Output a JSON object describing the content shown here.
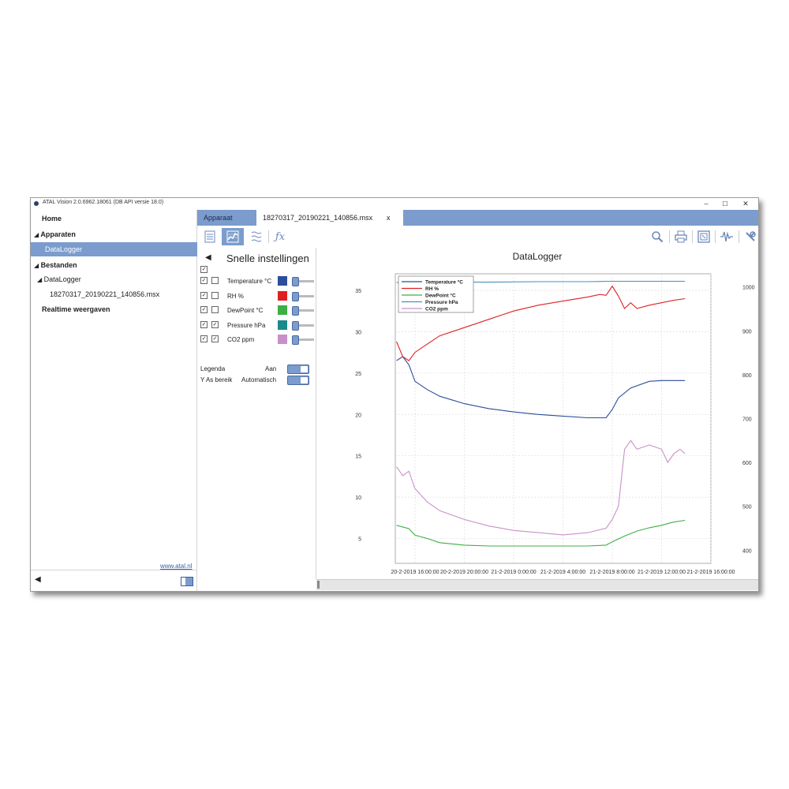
{
  "window": {
    "title": "ATAL Vision 2.0.6962.18061 (DB API versie 18.0)",
    "controls": {
      "minimize": "–",
      "maximize": "☐",
      "close": "✕"
    }
  },
  "sidebar": {
    "items": [
      {
        "label": "Home",
        "style": "bold"
      },
      {
        "label": "Apparaten",
        "style": "bold",
        "expander": "expanded"
      },
      {
        "label": "DataLogger",
        "style": "selected"
      },
      {
        "label": "Bestanden",
        "style": "bold",
        "expander": "expanded"
      },
      {
        "label": "DataLogger",
        "expander": "expanded"
      },
      {
        "label": "18270317_20190221_140856.msx"
      },
      {
        "label": "Realtime weergaven",
        "style": "bold"
      }
    ],
    "link": "www.atal.nl"
  },
  "tabs": {
    "apparaat": "Apparaat",
    "file": "18270317_20190221_140856.msx",
    "close": "x"
  },
  "quick_settings": {
    "title": "Snelle instellingen",
    "series": [
      {
        "label": "Temperature °C",
        "visible": true,
        "second_check": false,
        "color": "#2b4d9a"
      },
      {
        "label": "RH %",
        "visible": true,
        "second_check": false,
        "color": "#e02020"
      },
      {
        "label": "DewPoint °C",
        "visible": true,
        "second_check": false,
        "color": "#3cb043"
      },
      {
        "label": "Pressure hPa",
        "visible": true,
        "second_check": true,
        "color": "#1a8a8a"
      },
      {
        "label": "CO2 ppm",
        "visible": true,
        "second_check": true,
        "color": "#c890c8"
      }
    ],
    "legenda_label": "Legenda",
    "legenda_value": "Aan",
    "yas_label": "Y As bereik",
    "yas_value": "Automatisch"
  },
  "chart_data": {
    "type": "line",
    "title": "DataLogger",
    "legend": [
      "Temperature °C",
      "RH %",
      "DewPoint °C",
      "Pressure hPa",
      "CO2 ppm"
    ],
    "legend_position": "top-left",
    "grid": true,
    "x_ticks": [
      "20-2-2019 16:00:00",
      "20-2-2019 20:00:00",
      "21-2-2019 0:00:00",
      "21-2-2019 4:00:00",
      "21-2-2019 8:00:00",
      "21-2-2019 12:00:00",
      "21-2-2019 16:00:00"
    ],
    "x_range_hours": [
      0,
      24
    ],
    "y_left_ticks": [
      5,
      10,
      15,
      20,
      25,
      30,
      35
    ],
    "y_left_range": [
      2,
      37
    ],
    "y_right_ticks": [
      400,
      500,
      600,
      700,
      800,
      900,
      1000
    ],
    "y_right_range": [
      370,
      1030
    ],
    "series": [
      {
        "name": "Temperature °C",
        "axis": "left",
        "color": "#2b4d9a",
        "x": [
          14.5,
          15,
          15.5,
          16,
          17,
          18,
          20,
          22,
          0,
          2,
          4,
          6,
          7.5,
          8,
          8.5,
          9.5,
          11,
          12,
          13.9
        ],
        "y": [
          26.5,
          27,
          26,
          24,
          23,
          22.2,
          21.3,
          20.7,
          20.3,
          20,
          19.8,
          19.6,
          19.6,
          20.6,
          22,
          23.2,
          24,
          24.1,
          24.1
        ]
      },
      {
        "name": "RH %",
        "axis": "left",
        "color": "#e02020",
        "x": [
          14.5,
          15,
          15.5,
          16,
          17,
          18,
          20,
          22,
          0,
          2,
          4,
          6,
          7,
          7.5,
          8,
          8.5,
          9,
          9.5,
          10,
          11,
          12,
          13,
          13.9
        ],
        "y": [
          28.8,
          27,
          26.5,
          27.5,
          28.5,
          29.5,
          30.5,
          31.5,
          32.5,
          33.2,
          33.7,
          34.2,
          34.5,
          34.4,
          35.5,
          34.3,
          32.8,
          33.5,
          32.8,
          33.2,
          33.5,
          33.8,
          34
        ]
      },
      {
        "name": "DewPoint °C",
        "axis": "left",
        "color": "#3cb043",
        "x": [
          14.5,
          15.5,
          16,
          17,
          18,
          20,
          22,
          0,
          2,
          4,
          6,
          7.5,
          8,
          9,
          10,
          11,
          12,
          13,
          13.9
        ],
        "y": [
          6.6,
          6.2,
          5.4,
          5,
          4.5,
          4.2,
          4.1,
          4.1,
          4.1,
          4.1,
          4.1,
          4.2,
          4.6,
          5.3,
          5.9,
          6.3,
          6.6,
          7,
          7.2
        ]
      },
      {
        "name": "Pressure hPa",
        "axis": "right",
        "color": "#4a90b8",
        "x": [
          14.5,
          18,
          22,
          2,
          6,
          8,
          10,
          13.9
        ],
        "y": [
          1010,
          1011,
          1011,
          1012,
          1012,
          1013,
          1013,
          1013
        ]
      },
      {
        "name": "CO2 ppm",
        "axis": "right",
        "color": "#c890c8",
        "x": [
          14.5,
          15,
          15.5,
          16,
          17,
          18,
          20,
          22,
          0,
          2,
          4,
          6,
          7.5,
          8,
          8.5,
          9,
          9.5,
          10,
          11,
          12,
          12.5,
          13,
          13.5,
          13.9
        ],
        "y": [
          590,
          570,
          580,
          540,
          510,
          490,
          470,
          455,
          445,
          440,
          435,
          440,
          450,
          470,
          500,
          630,
          650,
          630,
          640,
          630,
          600,
          620,
          630,
          620
        ]
      }
    ]
  }
}
